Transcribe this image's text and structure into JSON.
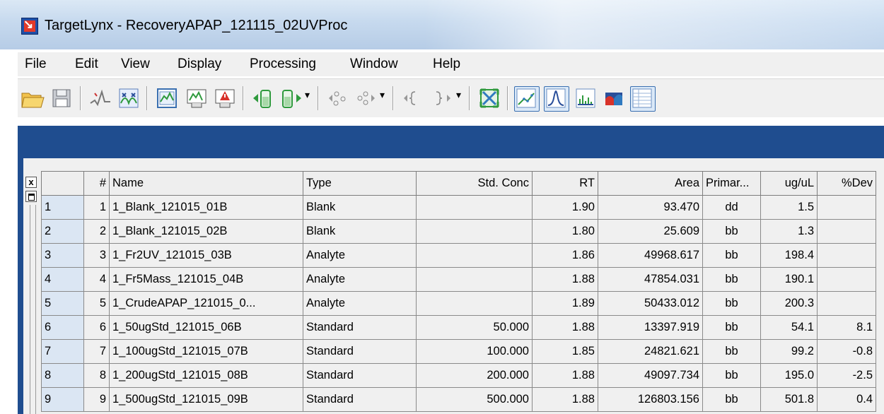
{
  "window": {
    "title": "TargetLynx - RecoveryAPAP_121115_02UVProc"
  },
  "menu": [
    "File",
    "Edit",
    "View",
    "Display",
    "Processing",
    "Window",
    "Help"
  ],
  "toolbar": {
    "icons": [
      "open-folder-icon",
      "save-icon",
      "integrate-icon",
      "smooth-icon",
      "chromatogram-icon",
      "report-icon",
      "report-alert-icon",
      "previous-sample-icon",
      "next-sample-icon",
      "previous-compound-icon",
      "next-compound-icon",
      "previous-peak-icon",
      "next-peak-icon",
      "zoom-fit-icon",
      "calibration-view-icon",
      "peak-view-icon",
      "spectrum-view-icon",
      "summary-view-icon",
      "table-view-icon"
    ]
  },
  "pane": {
    "close_glyph": "x"
  },
  "table": {
    "columns": [
      "",
      "#",
      "Name",
      "Type",
      "Std. Conc",
      "RT",
      "Area",
      "Primar...",
      "ug/uL",
      "%Dev"
    ],
    "rows": [
      [
        "1",
        "1",
        "1_Blank_121015_01B",
        "Blank",
        "",
        "1.90",
        "93.470",
        "dd",
        "1.5",
        ""
      ],
      [
        "2",
        "2",
        "1_Blank_121015_02B",
        "Blank",
        "",
        "1.80",
        "25.609",
        "bb",
        "1.3",
        ""
      ],
      [
        "3",
        "3",
        "1_Fr2UV_121015_03B",
        "Analyte",
        "",
        "1.86",
        "49968.617",
        "bb",
        "198.4",
        ""
      ],
      [
        "4",
        "4",
        "1_Fr5Mass_121015_04B",
        "Analyte",
        "",
        "1.88",
        "47854.031",
        "bb",
        "190.1",
        ""
      ],
      [
        "5",
        "5",
        "1_CrudeAPAP_121015_0...",
        "Analyte",
        "",
        "1.89",
        "50433.012",
        "bb",
        "200.3",
        ""
      ],
      [
        "6",
        "6",
        "1_50ugStd_121015_06B",
        "Standard",
        "50.000",
        "1.88",
        "13397.919",
        "bb",
        "54.1",
        "8.1"
      ],
      [
        "7",
        "7",
        "1_100ugStd_121015_07B",
        "Standard",
        "100.000",
        "1.85",
        "24821.621",
        "bb",
        "99.2",
        "-0.8"
      ],
      [
        "8",
        "8",
        "1_200ugStd_121015_08B",
        "Standard",
        "200.000",
        "1.88",
        "49097.734",
        "bb",
        "195.0",
        "-2.5"
      ],
      [
        "9",
        "9",
        "1_500ugStd_121015_09B",
        "Standard",
        "500.000",
        "1.88",
        "126803.156",
        "bb",
        "501.8",
        "0.4"
      ]
    ]
  }
}
